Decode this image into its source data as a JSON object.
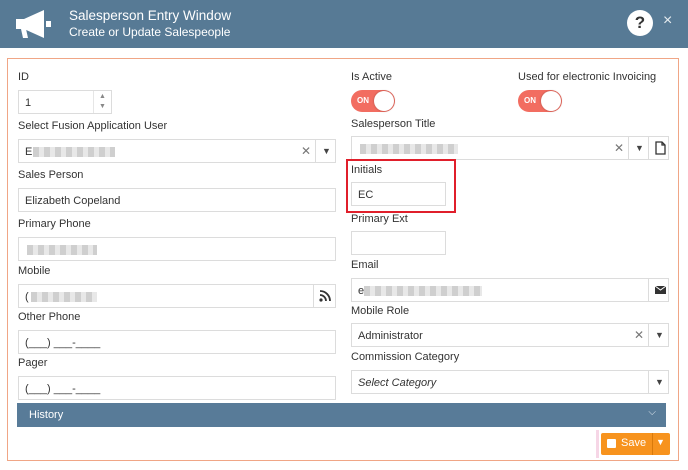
{
  "header": {
    "title": "Salesperson Entry Window",
    "subtitle": "Create or Update Salespeople",
    "help": "?",
    "close": "×"
  },
  "fields": {
    "id": {
      "label": "ID",
      "value": "1"
    },
    "fusion_user": {
      "label": "Select Fusion Application User",
      "value": "E"
    },
    "sales_person": {
      "label": "Sales Person",
      "value": "Elizabeth Copeland"
    },
    "primary_phone": {
      "label": "Primary Phone"
    },
    "mobile": {
      "label": "Mobile",
      "value": "("
    },
    "other_phone": {
      "label": "Other Phone",
      "value": "(___) ___-____"
    },
    "pager": {
      "label": "Pager",
      "value": "(___) ___-____"
    },
    "is_active": {
      "label": "Is Active",
      "toggle": "ON"
    },
    "e_invoicing": {
      "label": "Used for electronic Invoicing",
      "toggle": "ON"
    },
    "salesperson_title": {
      "label": "Salesperson Title"
    },
    "initials": {
      "label": "Initials",
      "value": "EC"
    },
    "primary_ext": {
      "label": "Primary Ext"
    },
    "email": {
      "label": "Email",
      "value": "e"
    },
    "mobile_role": {
      "label": "Mobile Role",
      "value": "Administrator"
    },
    "commission_category": {
      "label": "Commission Category",
      "placeholder": "Select Category"
    }
  },
  "history": {
    "label": "History",
    "chevron": "⌵"
  },
  "save": {
    "label": "Save",
    "dropdown": "▼"
  },
  "colors": {
    "header_bg": "#577a95",
    "toggle_on": "#f26d61",
    "save_bg": "#f7931e",
    "highlight": "#e01f2b",
    "history_bg": "#587b98"
  }
}
